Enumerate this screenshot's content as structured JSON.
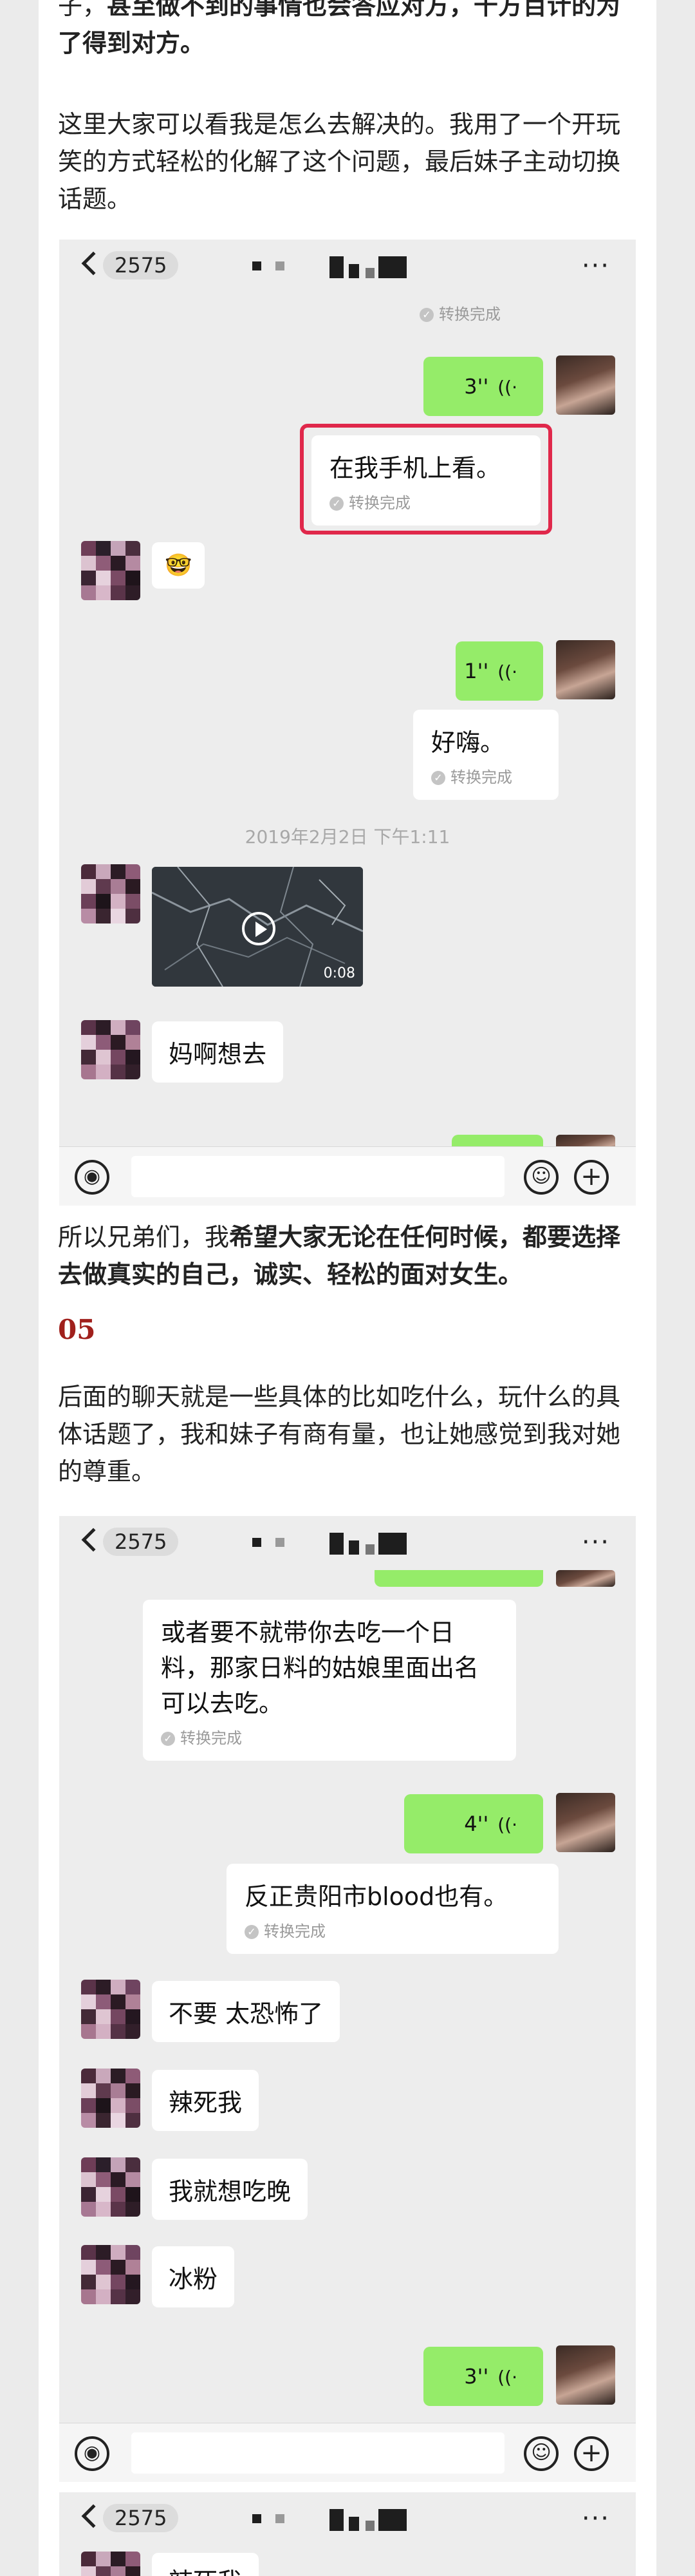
{
  "article": {
    "p1_normal": "子，",
    "p1_bold": "甚至做不到的事情也会答应对方，千方百计的为了得到对方。",
    "p2": "这里大家可以看我是怎么去解决的。我用了一个开玩笑的方式轻松的化解了这个问题，最后妹子主动切换话题。",
    "p3_normal": "所以兄弟们，我",
    "p3_bold": "希望大家无论在任何时候，都要选择去做真实的自己，诚实、轻松的面对女生。",
    "section_number": "05",
    "p4": "后面的聊天就是一些具体的比如吃什么，玩什么的具体话题了，我和妹子有商有量，也让她感觉到我对她的尊重。"
  },
  "chat_header": {
    "back_count": "2575",
    "more": "···"
  },
  "common": {
    "converted": "转换完成",
    "check": "✓"
  },
  "chat1": {
    "voice1": "3''",
    "msg_self1": "在我手机上看。",
    "emoji": "🤓",
    "voice2": "1''",
    "msg_self2": "好嗨。",
    "timestamp": "2019年2月2日 下午1:11",
    "video_duration": "0:08",
    "msg_other1": "妈啊想去"
  },
  "chat2": {
    "msg_self1": "或者要不就带你去吃一个日料，那家日料的姑娘里面出名可以去吃。",
    "voice1": "4''",
    "msg_self2": "反正贵阳市blood也有。",
    "msg_other1": "不要 太恐怖了",
    "msg_other2": "辣死我",
    "msg_other3": "我就想吃晚",
    "msg_other4": "冰粉",
    "voice2": "3''"
  },
  "chat3": {
    "msg_other1": "辣死我"
  },
  "input_bar": {
    "voice_icon": "◉",
    "emoji_icon": "☺",
    "plus_icon": "+"
  }
}
